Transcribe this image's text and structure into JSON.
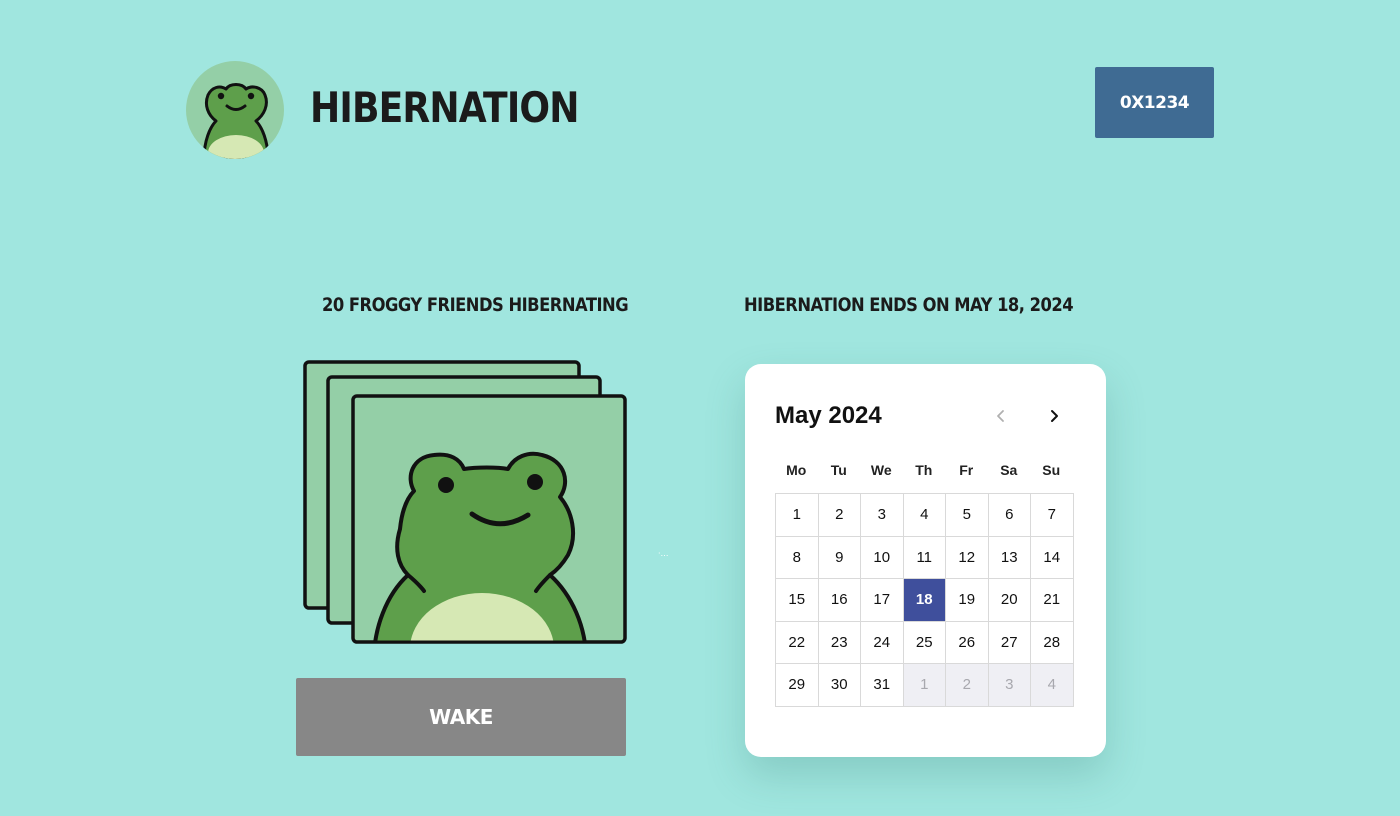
{
  "header": {
    "title": "HIBERNATION",
    "wallet_label": "0X1234"
  },
  "left_panel": {
    "heading": "20 FROGGY FRIENDS HIBERNATING",
    "wake_label": "WAKE"
  },
  "right_panel": {
    "heading": "HIBERNATION ENDS ON MAY 18, 2024"
  },
  "calendar": {
    "month_label": "May 2024",
    "prev_icon": "chevron-left-icon",
    "next_icon": "chevron-right-icon",
    "weekdays": [
      "Mo",
      "Tu",
      "We",
      "Th",
      "Fr",
      "Sa",
      "Su"
    ],
    "days": [
      {
        "label": "1",
        "current": true
      },
      {
        "label": "2",
        "current": true
      },
      {
        "label": "3",
        "current": true
      },
      {
        "label": "4",
        "current": true
      },
      {
        "label": "5",
        "current": true
      },
      {
        "label": "6",
        "current": true
      },
      {
        "label": "7",
        "current": true
      },
      {
        "label": "8",
        "current": true
      },
      {
        "label": "9",
        "current": true
      },
      {
        "label": "10",
        "current": true
      },
      {
        "label": "11",
        "current": true
      },
      {
        "label": "12",
        "current": true
      },
      {
        "label": "13",
        "current": true
      },
      {
        "label": "14",
        "current": true
      },
      {
        "label": "15",
        "current": true
      },
      {
        "label": "16",
        "current": true
      },
      {
        "label": "17",
        "current": true
      },
      {
        "label": "18",
        "current": true,
        "selected": true
      },
      {
        "label": "19",
        "current": true
      },
      {
        "label": "20",
        "current": true
      },
      {
        "label": "21",
        "current": true
      },
      {
        "label": "22",
        "current": true
      },
      {
        "label": "23",
        "current": true
      },
      {
        "label": "24",
        "current": true
      },
      {
        "label": "25",
        "current": true
      },
      {
        "label": "26",
        "current": true
      },
      {
        "label": "27",
        "current": true
      },
      {
        "label": "28",
        "current": true
      },
      {
        "label": "29",
        "current": true
      },
      {
        "label": "30",
        "current": true
      },
      {
        "label": "31",
        "current": true
      },
      {
        "label": "1",
        "current": false
      },
      {
        "label": "2",
        "current": false
      },
      {
        "label": "3",
        "current": false
      },
      {
        "label": "4",
        "current": false
      }
    ]
  },
  "colors": {
    "background": "#a0e6df",
    "wallet_button": "#3f6b93",
    "wake_button": "#878787",
    "selected_day": "#3f4f9c",
    "frog_green": "#5e9f4b",
    "card_green": "#94cfa7"
  }
}
